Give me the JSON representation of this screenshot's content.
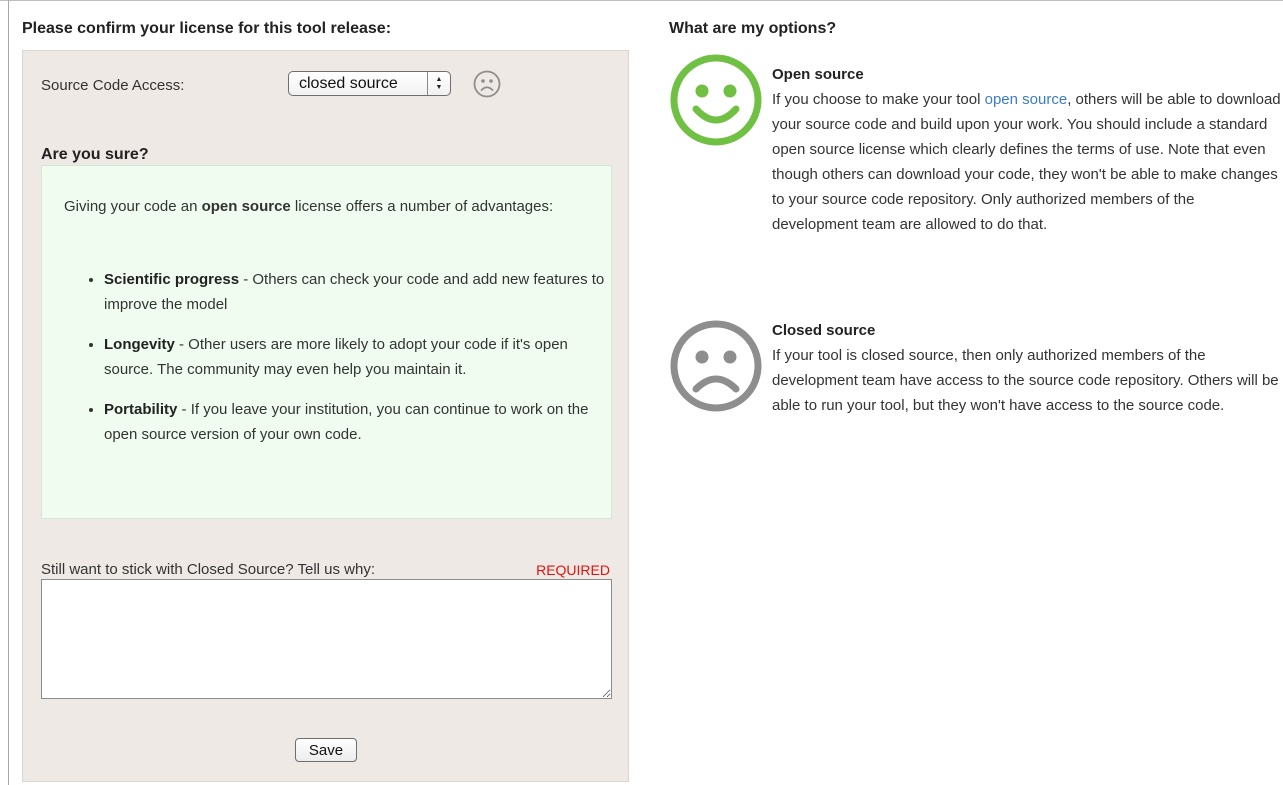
{
  "form": {
    "heading": "Please confirm your license for this tool release:",
    "source_access_label": "Source Code Access:",
    "source_access_value": "closed source",
    "are_you_sure_heading": "Are you sure?",
    "intro_before": "Giving your code an ",
    "intro_bold": "open source",
    "intro_after": " license offers a number of advantages:",
    "advantages": [
      {
        "title": "Scientific progress",
        "text": " - Others can check your code and add new features to improve the model"
      },
      {
        "title": "Longevity",
        "text": " - Other users are more likely to adopt your code if it's open source. The community may even help you maintain it."
      },
      {
        "title": "Portability",
        "text": " - If you leave your institution, you can continue to work on the open source version of your own code."
      }
    ],
    "reason_label": "Still want to stick with Closed Source? Tell us why:",
    "required_label": "REQUIRED",
    "reason_value": "",
    "save_label": "Save"
  },
  "options": {
    "heading": "What are my options?",
    "open_source": {
      "title": "Open source",
      "desc_before": "If you choose to make your tool ",
      "link_text": "open source",
      "desc_after": ", others will be able to download your source code and build upon your work. You should include a standard open source license which clearly defines the terms of use. Note that even though others can download your code, they won't be able to make changes to your source code repository. Only authorized members of the development team are allowed to do that.",
      "icon": "smiley-face-icon"
    },
    "closed_source": {
      "title": "Closed source",
      "desc": "If your tool is closed source, then only authorized members of the development team have access to the source code repository. Others will be able to run your tool, but they won't have access to the source code.",
      "icon": "sad-face-icon"
    }
  },
  "colors": {
    "panel_background": "#efe9e5",
    "advantages_background": "#f1fcf1",
    "happy_green": "#6fc043",
    "sad_gray": "#8e8e8e",
    "required_red": "#e1120f",
    "link_blue": "#3b7dc4"
  }
}
